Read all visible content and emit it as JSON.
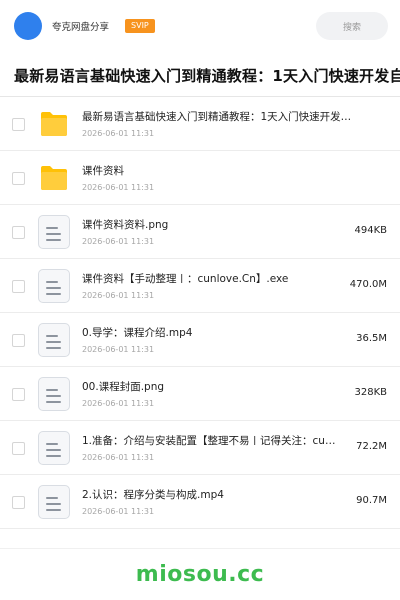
{
  "header": {
    "user_name": "夸克网盘分享",
    "badge": "SVIP",
    "search_label": "搜索"
  },
  "page_title": "最新易语言基础快速入门到精通教程：1天入门快速开发自",
  "files": [
    {
      "type": "folder",
      "name": "最新易语言基础快速入门到精通教程：1天入门快速开发…",
      "date": "2026-06-01 11:31",
      "size": ""
    },
    {
      "type": "folder",
      "name": "课件资料",
      "date": "2026-06-01 11:31",
      "size": ""
    },
    {
      "type": "file",
      "name": "课件资料资料.png",
      "date": "2026-06-01 11:31",
      "size": "494KB"
    },
    {
      "type": "file",
      "name": "课件资料【手动整理〡：cunlove.Cn】.exe",
      "date": "2026-06-01 11:31",
      "size": "470.0M"
    },
    {
      "type": "file",
      "name": "0.导学：课程介绍.mp4",
      "date": "2026-06-01 11:31",
      "size": "36.5M"
    },
    {
      "type": "file",
      "name": "00.课程封面.png",
      "date": "2026-06-01 11:31",
      "size": "328KB"
    },
    {
      "type": "file",
      "name": "1.准备：介绍与安装配置【整理不易〡记得关注：cu…",
      "date": "2026-06-01 11:31",
      "size": "72.2M"
    },
    {
      "type": "file",
      "name": "2.认识：程序分类与构成.mp4",
      "date": "2026-06-01 11:31",
      "size": "90.7M"
    }
  ],
  "watermark": "miosou.cc",
  "colors": {
    "avatar": "#2f80ed",
    "svip": "#f7931e",
    "folder": "#ffc107",
    "watermark": "#3dbb4f"
  }
}
